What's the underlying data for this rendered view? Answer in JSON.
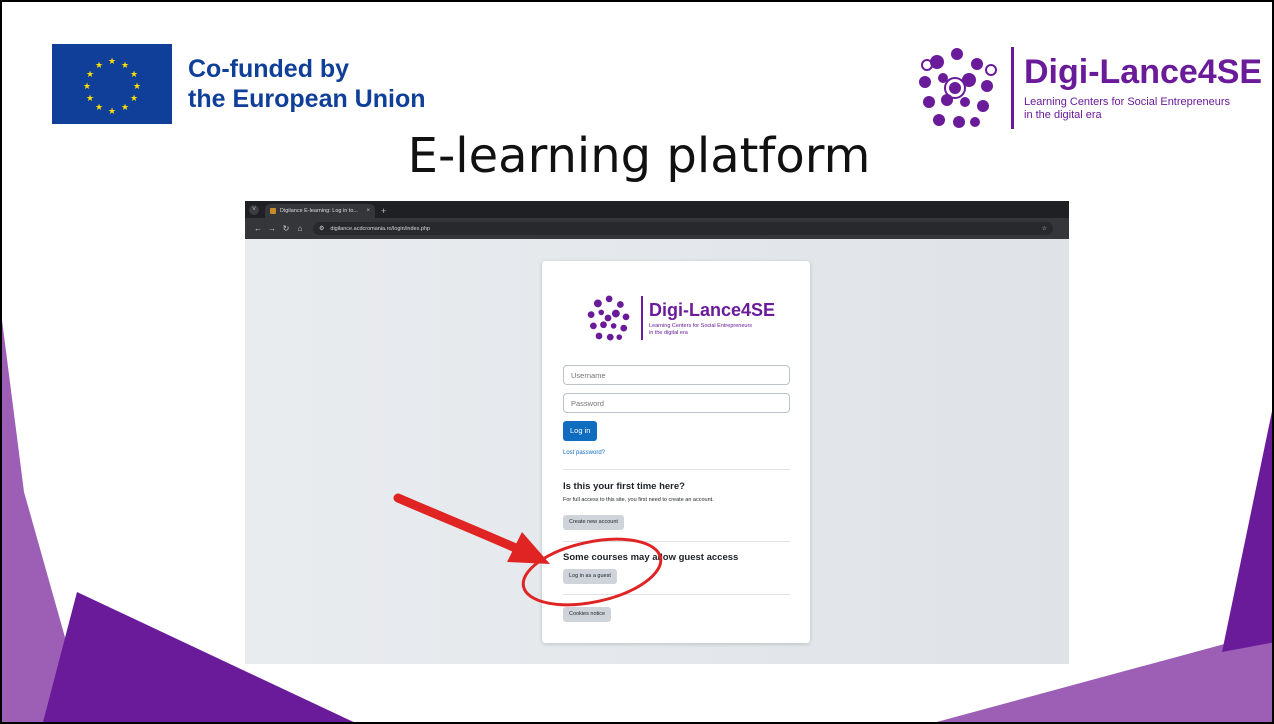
{
  "slide": {
    "title": "E-learning platform",
    "colors": {
      "accent_purple": "#6a1b9a",
      "light_purple": "#9c5fb5",
      "eu_blue": "#0f3f98",
      "eu_yellow": "#ffdd00",
      "annotation_red": "#e02424"
    }
  },
  "eu_logo": {
    "line1": "Co-funded by",
    "line2": "the European Union",
    "icon": "eu-flag-icon"
  },
  "project_logo": {
    "name": "Digi-Lance4SE",
    "tagline_line1": "Learning Centers for Social Entrepreneurs",
    "tagline_line2": "in the digital era",
    "icon": "icon-cluster-logo"
  },
  "browser": {
    "tab_title": "Digilance E-learning: Log in to...",
    "url": "digilance.acdcromania.ro/login/index.php",
    "new_tab": "+",
    "close_tab": "×"
  },
  "login": {
    "username_placeholder": "Username",
    "password_placeholder": "Password",
    "login_button": "Log in",
    "lost_password": "Lost password?",
    "first_time_heading": "Is this your first time here?",
    "first_time_text": "For full access to this site, you first need to create an account.",
    "create_account_button": "Create new account",
    "guest_heading": "Some courses may allow guest access",
    "guest_button": "Log in as a guest",
    "cookies_button": "Cookies notice"
  }
}
